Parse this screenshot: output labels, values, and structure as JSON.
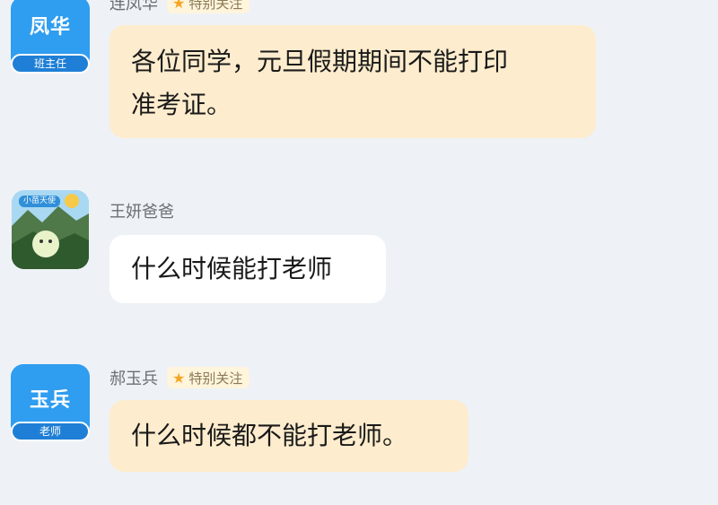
{
  "messages": [
    {
      "sender": "连凤华",
      "avatar_text": "凤华",
      "role_label": "班主任",
      "badge": "特别关注",
      "text_lines": [
        "各位同学，元旦假期期间不能打印",
        "准考证。"
      ]
    },
    {
      "sender": "王妍爸爸",
      "avatar_text": "小苗天使",
      "text_lines": [
        "什么时候能打老师"
      ]
    },
    {
      "sender": "郝玉兵",
      "avatar_text": "玉兵",
      "role_label": "老师",
      "badge": "特别关注",
      "text_lines": [
        "什么时候都不能打老师。"
      ]
    }
  ],
  "icons": {
    "follow_badge_icon": "star-icon"
  },
  "colors": {
    "background": "#eef2f6",
    "teacher_bubble": "#fdeccd",
    "parent_bubble": "#ffffff",
    "avatar_blue": "#2f9df0",
    "badge_star": "#f5a623"
  }
}
